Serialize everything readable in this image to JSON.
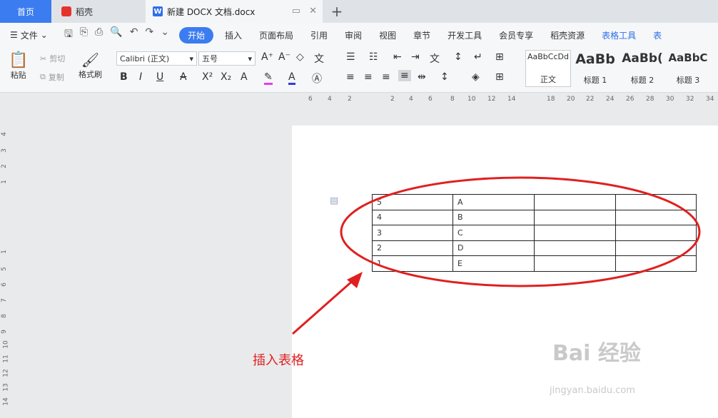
{
  "tabs": {
    "home": "首页",
    "daoke": "稻壳",
    "document": "新建 DOCX 文档.docx",
    "new_tab": "+"
  },
  "menubar": {
    "file": "文件",
    "items": [
      "开始",
      "插入",
      "页面布局",
      "引用",
      "审阅",
      "视图",
      "章节",
      "开发工具",
      "会员专享",
      "稻壳资源",
      "表格工具",
      "表"
    ]
  },
  "ribbon": {
    "paste": "粘贴",
    "cut": "剪切",
    "copy": "复制",
    "format_painter": "格式刷",
    "font_name": "Calibri (正文)",
    "font_size": "五号",
    "styles": [
      {
        "preview": "AaBbCcDd",
        "label": "正文"
      },
      {
        "preview": "AaBb",
        "label": "标题 1"
      },
      {
        "preview": "AaBb(",
        "label": "标题 2"
      },
      {
        "preview": "AaBbC",
        "label": "标题 3"
      }
    ]
  },
  "hruler": [
    "6",
    "4",
    "2",
    "2",
    "4",
    "6",
    "8",
    "10",
    "12",
    "14",
    "18",
    "20",
    "22",
    "24",
    "26",
    "28",
    "30",
    "32",
    "34"
  ],
  "vruler": [
    "4",
    "3",
    "2",
    "1",
    "1",
    "5",
    "6",
    "7",
    "8",
    "9",
    "10",
    "11",
    "12",
    "13",
    "14"
  ],
  "table": {
    "rows": [
      [
        "5",
        "A",
        "",
        ""
      ],
      [
        "4",
        "B",
        "",
        ""
      ],
      [
        "3",
        "C",
        "",
        ""
      ],
      [
        "2",
        "D",
        "",
        ""
      ],
      [
        "1",
        "E",
        "",
        ""
      ]
    ]
  },
  "annotation": "插入表格",
  "watermark": {
    "main": "Bai 经验",
    "sub": "jingyan.baidu.com"
  },
  "colors": {
    "accent": "#3b7cf0",
    "annotation_red": "#e02020"
  }
}
